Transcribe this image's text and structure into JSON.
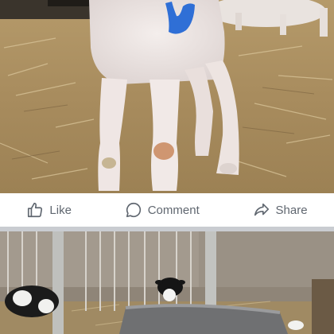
{
  "post1": {
    "photo_alt": "",
    "actions": {
      "like_label": "Like",
      "comment_label": "Comment",
      "share_label": "Share"
    }
  },
  "icons": {
    "like": "thumbs-up-icon",
    "comment": "speech-bubble-icon",
    "share": "share-arrow-icon"
  },
  "colors": {
    "action_text": "#606770",
    "divider": "#c9ccd1",
    "paint_mark": "#2f6fd6"
  }
}
